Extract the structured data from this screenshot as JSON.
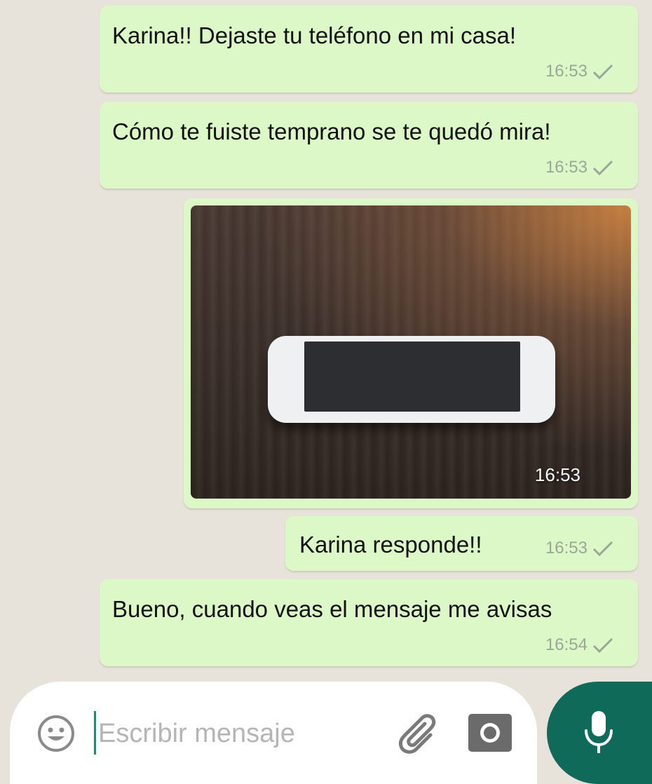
{
  "messages": [
    {
      "text": "Karina!! Dejaste tu teléfono en mi casa!",
      "time": "16:53"
    },
    {
      "text": "Cómo te fuiste temprano se te quedó mira!",
      "time": "16:53"
    },
    {
      "type": "image",
      "time": "16:53"
    },
    {
      "text": "Karina responde!!",
      "time": "16:53"
    },
    {
      "text": "Bueno, cuando veas el mensaje me avisas",
      "time": "16:54"
    }
  ],
  "composer": {
    "placeholder": "Escribir mensaje",
    "emoji_icon": "emoji-icon",
    "attach_icon": "paperclip-icon",
    "camera_icon": "camera-icon",
    "mic_icon": "microphone-icon"
  },
  "colors": {
    "outgoing_bubble": "#dcf8c6",
    "chat_background": "#e8e3da",
    "accent": "#0f6a5a"
  }
}
